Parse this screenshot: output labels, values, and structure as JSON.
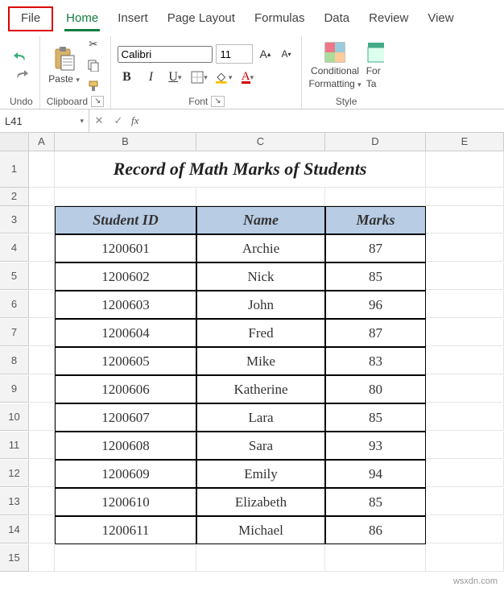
{
  "tabs": {
    "file": "File",
    "home": "Home",
    "insert": "Insert",
    "page_layout": "Page Layout",
    "formulas": "Formulas",
    "data": "Data",
    "review": "Review",
    "view": "View"
  },
  "ribbon": {
    "undo_group": "Undo",
    "clipboard": {
      "paste": "Paste",
      "label": "Clipboard"
    },
    "font": {
      "name": "Calibri",
      "size": "11",
      "bold": "B",
      "italic": "I",
      "underline": "U",
      "label": "Font"
    },
    "styles": {
      "cond_fmt_l1": "Conditional",
      "cond_fmt_l2": "Formatting",
      "format_table_l1": "For",
      "format_table_l2": "Ta",
      "label": "Style"
    }
  },
  "namebox": "L41",
  "fx": "fx",
  "columns": [
    "A",
    "B",
    "C",
    "D",
    "E"
  ],
  "rows": [
    "1",
    "2",
    "3",
    "4",
    "5",
    "6",
    "7",
    "8",
    "9",
    "10",
    "11",
    "12",
    "13",
    "14",
    "15"
  ],
  "title": "Record of Math Marks of Students",
  "headers": {
    "id": "Student ID",
    "name": "Name",
    "marks": "Marks"
  },
  "data": [
    {
      "id": "1200601",
      "name": "Archie",
      "marks": "87"
    },
    {
      "id": "1200602",
      "name": "Nick",
      "marks": "85"
    },
    {
      "id": "1200603",
      "name": "John",
      "marks": "96"
    },
    {
      "id": "1200604",
      "name": "Fred",
      "marks": "87"
    },
    {
      "id": "1200605",
      "name": "Mike",
      "marks": "83"
    },
    {
      "id": "1200606",
      "name": "Katherine",
      "marks": "80"
    },
    {
      "id": "1200607",
      "name": "Lara",
      "marks": "85"
    },
    {
      "id": "1200608",
      "name": "Sara",
      "marks": "93"
    },
    {
      "id": "1200609",
      "name": "Emily",
      "marks": "94"
    },
    {
      "id": "1200610",
      "name": "Elizabeth",
      "marks": "85"
    },
    {
      "id": "1200611",
      "name": "Michael",
      "marks": "86"
    }
  ],
  "watermark": "wsxdn.com"
}
